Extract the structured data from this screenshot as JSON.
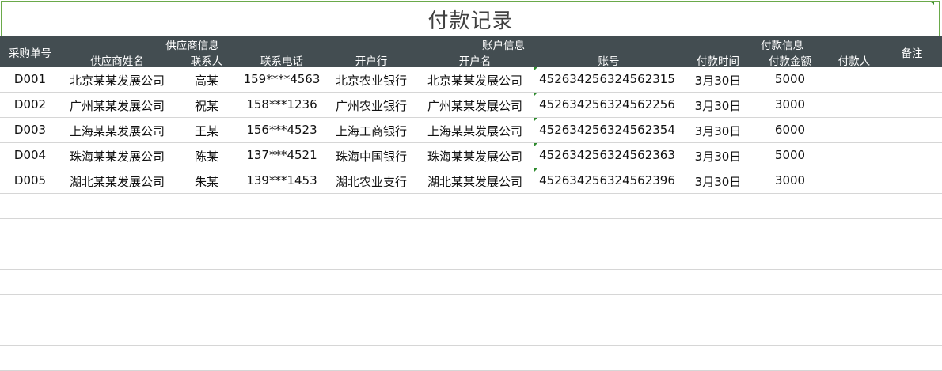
{
  "title": "付款记录",
  "header": {
    "order_no": "采购单号",
    "supplier_group": "供应商信息",
    "supplier_name": "供应商姓名",
    "contact": "联系人",
    "phone": "联系电话",
    "account_group": "账户信息",
    "bank": "开户行",
    "account_name": "开户名",
    "account_no": "账号",
    "payment_group": "付款信息",
    "pay_time": "付款时间",
    "pay_amount": "付款金额",
    "payer": "付款人",
    "remark": "备注"
  },
  "rows": [
    {
      "order_no": "D001",
      "supplier_name": "北京某某发展公司",
      "contact": "高某",
      "phone": "159****4563",
      "bank": "北京农业银行",
      "account_name": "北京某某发展公司",
      "account_no": "452634256324562315",
      "pay_time": "3月30日",
      "pay_amount": "5000",
      "payer": "",
      "remark": ""
    },
    {
      "order_no": "D002",
      "supplier_name": "广州某某发展公司",
      "contact": "祝某",
      "phone": "158***1236",
      "bank": "广州农业银行",
      "account_name": "广州某某发展公司",
      "account_no": "452634256324562256",
      "pay_time": "3月30日",
      "pay_amount": "3000",
      "payer": "",
      "remark": ""
    },
    {
      "order_no": "D003",
      "supplier_name": "上海某某发展公司",
      "contact": "王某",
      "phone": "156***4523",
      "bank": "上海工商银行",
      "account_name": "上海某某发展公司",
      "account_no": "452634256324562354",
      "pay_time": "3月30日",
      "pay_amount": "6000",
      "payer": "",
      "remark": ""
    },
    {
      "order_no": "D004",
      "supplier_name": "珠海某某发展公司",
      "contact": "陈某",
      "phone": "137***4521",
      "bank": "珠海中国银行",
      "account_name": "珠海某某发展公司",
      "account_no": "452634256324562363",
      "pay_time": "3月30日",
      "pay_amount": "5000",
      "payer": "",
      "remark": ""
    },
    {
      "order_no": "D005",
      "supplier_name": "湖北某某发展公司",
      "contact": "朱某",
      "phone": "139***1453",
      "bank": "湖北农业支行",
      "account_name": "湖北某某发展公司",
      "account_no": "452634256324562396",
      "pay_time": "3月30日",
      "pay_amount": "3000",
      "payer": "",
      "remark": ""
    }
  ],
  "colors": {
    "header_bg": "#434d51",
    "title_border": "#6aa94a",
    "indicator": "#2e8b2e"
  }
}
